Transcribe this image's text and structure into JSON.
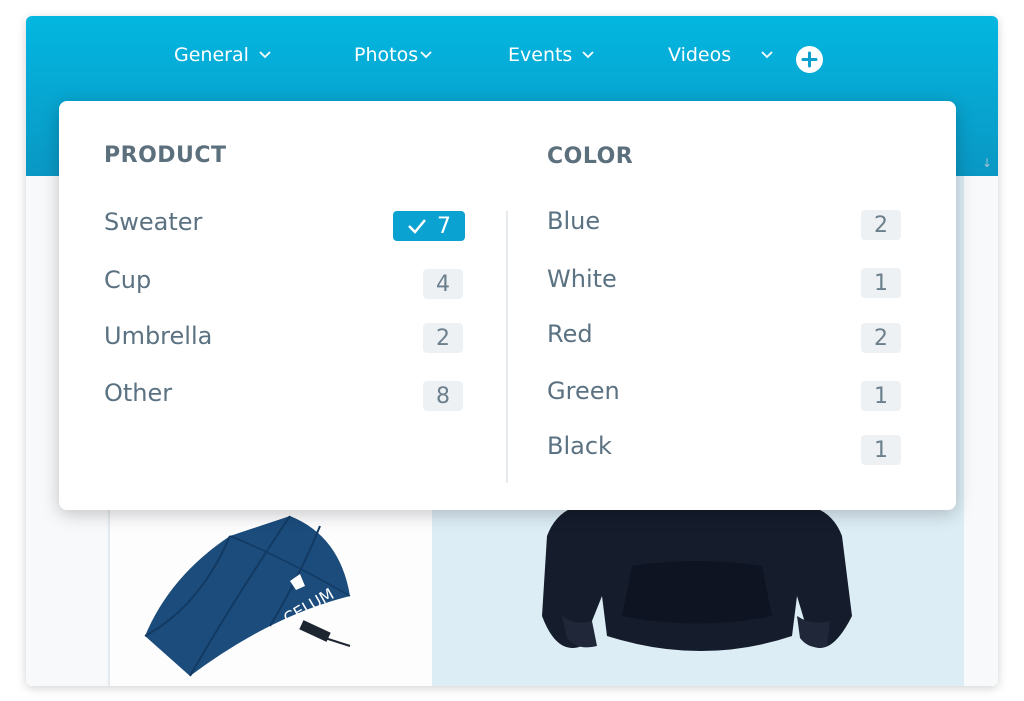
{
  "nav": {
    "items": [
      {
        "label": "General"
      },
      {
        "label": "Photos"
      },
      {
        "label": "Events"
      },
      {
        "label": "Videos"
      }
    ]
  },
  "filters": {
    "product": {
      "title": "PRODUCT",
      "items": [
        {
          "label": "Sweater",
          "count": "7",
          "selected": true
        },
        {
          "label": "Cup",
          "count": "4"
        },
        {
          "label": "Umbrella",
          "count": "2"
        },
        {
          "label": "Other",
          "count": "8"
        }
      ]
    },
    "color": {
      "title": "COLOR",
      "items": [
        {
          "label": "Blue",
          "count": "2"
        },
        {
          "label": "White",
          "count": "1"
        },
        {
          "label": "Red",
          "count": "2"
        },
        {
          "label": "Green",
          "count": "1"
        },
        {
          "label": "Black",
          "count": "1"
        }
      ]
    }
  },
  "brand_text": "CELUM",
  "colors": {
    "accent": "#0aa3d1",
    "header_top": "#03b7e0",
    "header_bottom": "#0a97c4"
  }
}
